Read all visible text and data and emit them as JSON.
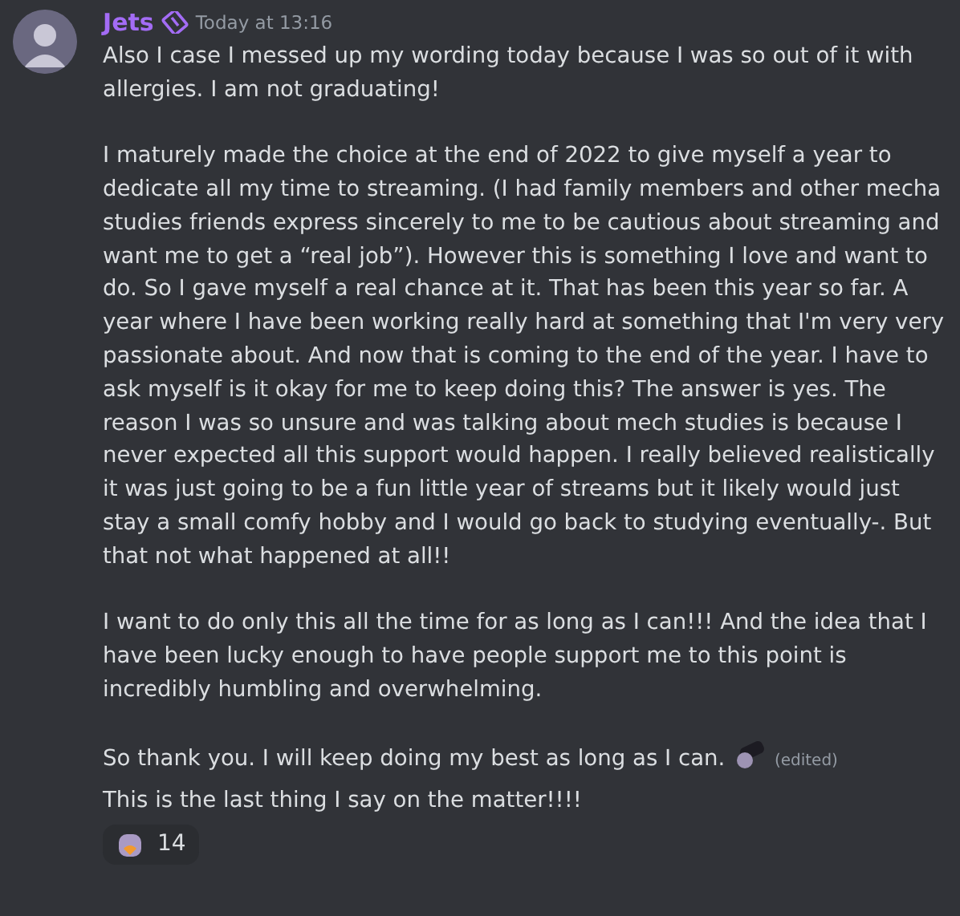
{
  "message": {
    "author": "Jets",
    "timestamp": "Today at 13:16",
    "paragraphs": [
      "Also I case I messed up my wording today because I was so out of it with allergies. I am not graduating!",
      "I maturely made the choice at the end of 2022 to give myself a year to dedicate all my time to streaming. (I had family members and other mecha studies friends express sincerely to me to be cautious about streaming and want me to get a “real job”). However this is something I love and want to do. So I gave myself a real chance at it. That has been this year so far. A year where I have been working really hard at something that I'm very very passionate about. And now that is coming to the end of the year. I have to ask myself is it okay for me to keep doing this? The answer is yes. The reason I was so unsure and was talking about mech studies is because I never expected all this support would happen. I really believed realistically it was just going to be a fun little year of streams but it likely would just stay a small comfy hobby and I would go back to studying eventually-. But that not what happened at all!!",
      "I want to do only this all the time for as long as I can!!! And the idea that I have been lucky enough to have people support me to this point is incredibly humbling and overwhelming.",
      "So thank you. I will keep doing my best as long as I can."
    ],
    "edited_tag": "(edited)"
  },
  "followup": "This is the last thing I say on the matter!!!!",
  "reaction": {
    "count": "14"
  }
}
